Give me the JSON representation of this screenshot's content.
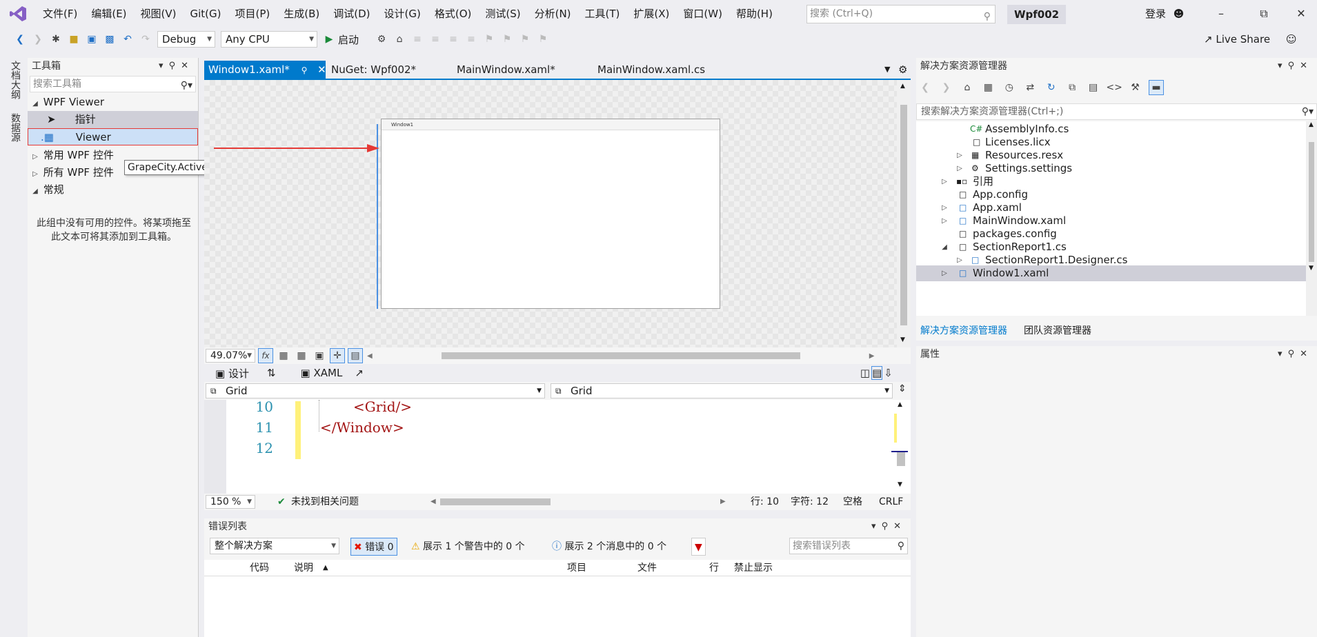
{
  "menu": [
    "文件(F)",
    "编辑(E)",
    "视图(V)",
    "Git(G)",
    "项目(P)",
    "生成(B)",
    "调试(D)",
    "设计(G)",
    "格式(O)",
    "测试(S)",
    "分析(N)",
    "工具(T)",
    "扩展(X)",
    "窗口(W)",
    "帮助(H)"
  ],
  "search_placeholder": "搜索 (Ctrl+Q)",
  "solution_name": "Wpf002",
  "login_label": "登录",
  "toolbar": {
    "config": "Debug",
    "platform": "Any CPU",
    "start_label": "启动"
  },
  "live_share": "Live Share",
  "left_strip": [
    "文档大纲",
    "数据源"
  ],
  "toolbox": {
    "title": "工具箱",
    "search_placeholder": "搜索工具箱",
    "group1": "WPF Viewer",
    "pointer": "指针",
    "viewer": "Viewer",
    "tooltip": "GrapeCity.ActiveReports.Viewer.Wpf.Viewer",
    "group2": "常用 WPF 控件",
    "group3": "所有 WPF 控件",
    "group4": "常规",
    "empty_message": "此组中没有可用的控件。将某项拖至此文本可将其添加到工具箱。"
  },
  "tabs": [
    "Window1.xaml*",
    "NuGet: Wpf002*",
    "MainWindow.xaml*",
    "MainWindow.xaml.cs"
  ],
  "designer": {
    "window_title": "Window1",
    "zoom": "49.07%"
  },
  "split": {
    "design": "设计",
    "xaml": "XAML"
  },
  "nav": {
    "left": "Grid",
    "right": "Grid"
  },
  "code": {
    "lines": [
      "10",
      "11",
      "12"
    ],
    "text": [
      "<Grid/>",
      "</Window>",
      ""
    ]
  },
  "status": {
    "zoom": "150 %",
    "issues": "未找到相关问题",
    "row": "行: 10",
    "col": "字符: 12",
    "space": "空格",
    "eol": "CRLF"
  },
  "errorlist": {
    "title": "错误列表",
    "scope": "整个解决方案",
    "errors": "错误 0",
    "warnings": "展示 1 个警告中的 0 个",
    "messages": "展示 2 个消息中的 0 个",
    "search_placeholder": "搜索错误列表",
    "columns": [
      "代码",
      "说明",
      "项目",
      "文件",
      "行",
      "禁止显示"
    ]
  },
  "solution_explorer": {
    "title": "解决方案资源管理器",
    "search_placeholder": "搜索解决方案资源管理器(Ctrl+;)",
    "items": [
      "AssemblyInfo.cs",
      "Licenses.licx",
      "Resources.resx",
      "Settings.settings",
      "引用",
      "App.config",
      "App.xaml",
      "MainWindow.xaml",
      "packages.config",
      "SectionReport1.cs",
      "SectionReport1.Designer.cs",
      "Window1.xaml"
    ],
    "tab1": "解决方案资源管理器",
    "tab2": "团队资源管理器"
  },
  "properties": {
    "title": "属性"
  },
  "colors": {
    "accent": "#007acc",
    "highlight": "#cce0f7",
    "arrow": "#e53935"
  }
}
